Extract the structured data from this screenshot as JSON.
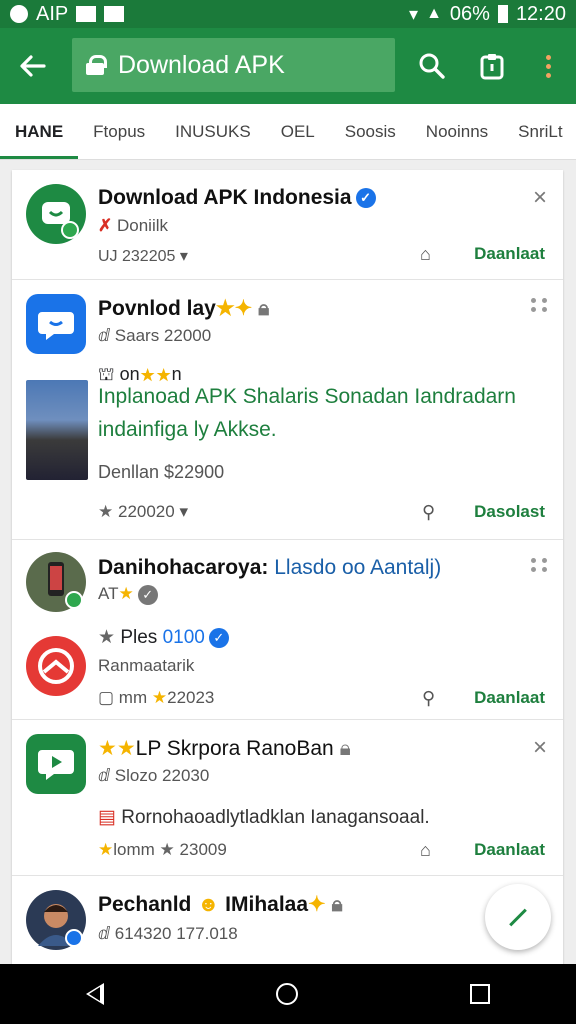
{
  "status_bar": {
    "left_text": "AIP",
    "battery": "06%",
    "time": "12:20"
  },
  "app_bar": {
    "search_text": "Download APK"
  },
  "tabs": [
    "HANE",
    "Ftopus",
    "INUSUKS",
    "OEL",
    "Soosis",
    "Nooinns",
    "SnriLt"
  ],
  "cards": [
    {
      "title": "Download APK Indonesia",
      "subtitle": "Doniilk",
      "meta": "UJ 232205",
      "action": "Daanlaat",
      "icon_color": "#1e8a43"
    },
    {
      "title": "Povnlod lay",
      "subtitle": "Saars 22000",
      "line2": "on",
      "desc": "Inplanoad APK Shalaris Sonadan Iandradarn indainfiga ly Akkse.",
      "price": "Denllan $22900",
      "meta": "220020",
      "action": "Dasolast",
      "icon_color": "#1a73e8"
    },
    {
      "title": "Danihohacaroya:",
      "title_link": "Llasdo oo Aantalj)",
      "subtitle": "AT",
      "line2": "Ples",
      "line2_link": "0100",
      "line3": "Ranmaatarik",
      "meta_left": "mm",
      "meta": "22023",
      "action": "Daanlaat",
      "icon_color": "#d93025"
    },
    {
      "title": "LP Skrpora RanoBan",
      "subtitle": "Slozo 22030",
      "line2": "Rornohaoadlytladklan Ianagansoaal.",
      "meta_left": "lomm",
      "meta": "23009",
      "action": "Daanlaat",
      "icon_color": "#1e8a43"
    },
    {
      "title": "Pechanld",
      "title2": "IMihalaa",
      "subtitle": "614320 177.018",
      "icon_color": "#2b3a55"
    }
  ]
}
